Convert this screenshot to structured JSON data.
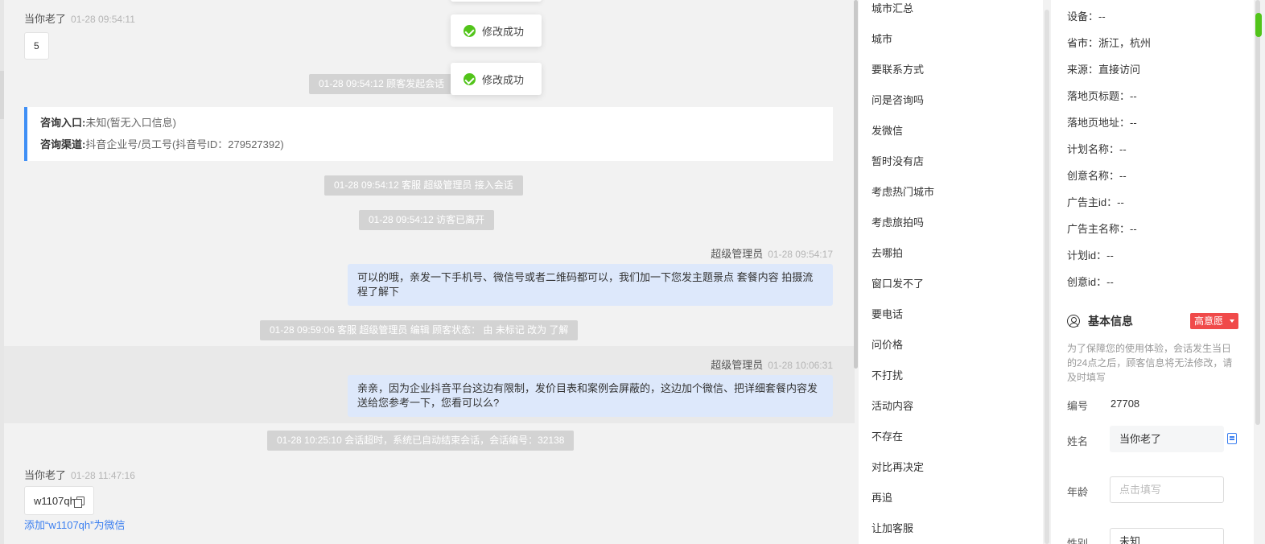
{
  "chat": {
    "msg1": {
      "sender": "当你老了",
      "time": "01-28 09:54:11",
      "content": "5"
    },
    "sys_start": "01-28 09:54:12 顾客发起会话",
    "consult": {
      "entry_label": "咨询入口:",
      "entry_value": "未知(暂无入口信息)",
      "channel_label": "咨询渠道:",
      "channel_value": "抖音企业号/员工号(抖音号ID：279527392)"
    },
    "sys_join": "01-28 09:54:12 客服 超级管理员 接入会话",
    "sys_leave": "01-28 09:54:12 访客已离开",
    "agent_msg1": {
      "sender": "超级管理员",
      "time": "01-28 09:54:17",
      "content": "可以的哦，亲发一下手机号、微信号或者二维码都可以，我们加一下您发主题景点 套餐内容 拍摄流程了解下"
    },
    "sys_edit": "01-28 09:59:06 客服 超级管理员 编辑 顾客状态： 由 未标记 改为 了解",
    "agent_msg2": {
      "sender": "超级管理员",
      "time": "01-28 10:06:31",
      "content": "亲亲，因为企业抖音平台这边有限制，发价目表和案例会屏蔽的，这边加个微信、把详细套餐内容发送给您参考一下，您看可以么?"
    },
    "sys_end": "01-28 10:25:10 会话超时，系统已自动结束会话，会话编号：32138",
    "msg2": {
      "sender": "当你老了",
      "time": "01-28 11:47:16",
      "content": "w1107qh"
    },
    "add_wechat_link": "添加“w1107qh”为微信"
  },
  "toasts": [
    "修改成功",
    "修改成功"
  ],
  "quick_replies": [
    "城市汇总",
    "城市",
    "要联系方式",
    "问是咨询吗",
    "发微信",
    "暂时没有店",
    "考虑热门城市",
    "考虑旅拍吗",
    "去哪拍",
    "窗口发不了",
    "要电话",
    "问价格",
    "不打扰",
    "活动内容",
    "不存在",
    "对比再决定",
    "再追",
    "让加客服"
  ],
  "visitor_info": [
    {
      "label": "设备：",
      "value": "--"
    },
    {
      "label": "省市：",
      "value": "浙江，杭州"
    },
    {
      "label": "来源：",
      "value": "直接访问"
    },
    {
      "label": "落地页标题：",
      "value": "--"
    },
    {
      "label": "落地页地址：",
      "value": "--"
    },
    {
      "label": "计划名称：",
      "value": "--"
    },
    {
      "label": "创意名称：",
      "value": "--"
    },
    {
      "label": "广告主id：",
      "value": "--"
    },
    {
      "label": "广告主名称：",
      "value": "--"
    },
    {
      "label": "计划id：",
      "value": "--"
    },
    {
      "label": "创意id：",
      "value": "--"
    }
  ],
  "basic": {
    "title": "基本信息",
    "intent_tag": "高意愿",
    "notice": "为了保障您的使用体验，会话发生当日的24点之后，顾客信息将无法修改，请及时填写",
    "id_label": "编号",
    "id_value": "27708",
    "name_label": "姓名",
    "name_value": "当你老了",
    "age_label": "年龄",
    "age_placeholder": "点击填写",
    "gender_label": "性别",
    "gender_value": "未知"
  },
  "colors": {
    "accent": "#3b7ff0",
    "success": "#52c41a",
    "intent": "#f04a4a",
    "agent_bubble": "#dde8fb"
  }
}
